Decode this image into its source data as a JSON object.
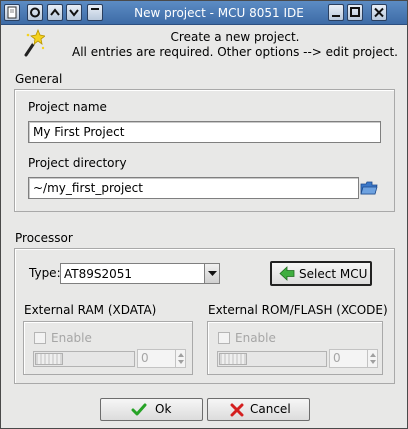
{
  "window": {
    "title": "New project - MCU 8051 IDE",
    "controls": [
      "window-menu",
      "sticky",
      "shade-up",
      "shade-down",
      "minimize",
      "maximize",
      "close"
    ]
  },
  "header": {
    "line1": "Create a new project.",
    "line2": "All entries are required. Other options --> edit project."
  },
  "general": {
    "section_title": "General",
    "project_name_label": "Project name",
    "project_name_value": "My First Project",
    "project_directory_label": "Project directory",
    "project_directory_value": "~/my_first_project"
  },
  "processor": {
    "section_title": "Processor",
    "type_label": "Type:",
    "type_value": "AT89S2051",
    "select_mcu_label": "Select MCU",
    "external_ram": {
      "title": "External RAM (XDATA)",
      "enable_label": "Enable",
      "enabled": false,
      "value": "0"
    },
    "external_rom": {
      "title": "External ROM/FLASH (XCODE)",
      "enable_label": "Enable",
      "enabled": false,
      "value": "0"
    }
  },
  "footer": {
    "ok_label": "Ok",
    "cancel_label": "Cancel"
  },
  "colors": {
    "titlebar": "#3d6ba6",
    "dialog_bg": "#e8e8e7",
    "ok_check": "#27a327",
    "cancel_x": "#d42020",
    "select_arrow": "#3fae3f",
    "folder": "#3c78c8"
  }
}
